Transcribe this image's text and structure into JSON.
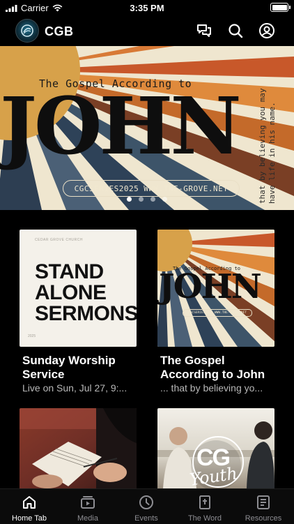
{
  "status": {
    "carrier": "Carrier",
    "time": "3:35 PM"
  },
  "header": {
    "app_name": "CGB"
  },
  "hero": {
    "subtitle": "The Gospel According to",
    "title": "JOHN",
    "vertical_text": "that by believing you may have life in his name.",
    "pill_text": "CGCSERIES2025  WWW.THE-GROVE.NET",
    "page_count": 4,
    "active_page": 1
  },
  "cards": [
    {
      "title": "Sunday Worship Service",
      "subtitle": "Live on Sun, Jul 27, 9:...",
      "thumb": {
        "church": "CEDAR GROVE CHURCH",
        "headline": [
          "STAND",
          "ALONE",
          "SERMONS"
        ],
        "year": "2025"
      }
    },
    {
      "title": "The Gospel According to John",
      "subtitle": "... that by believing yo...",
      "thumb": {
        "subtitle": "The Gospel According to",
        "title": "JOHN",
        "pill_text": "CGCSERIES2025  WWW.THE-GROVE.NET"
      }
    },
    {
      "title": "",
      "subtitle": "",
      "thumb": {
        "kind": "journal-photo"
      }
    },
    {
      "title": "",
      "subtitle": "",
      "thumb": {
        "kind": "youth-photo",
        "logo_text": "CG",
        "logo_script": "Youth"
      }
    }
  ],
  "tabs": [
    {
      "label": "Home Tab",
      "icon": "home-icon",
      "active": true
    },
    {
      "label": "Media",
      "icon": "media-icon",
      "active": false
    },
    {
      "label": "Events",
      "icon": "clock-icon",
      "active": false
    },
    {
      "label": "The Word",
      "icon": "bible-icon",
      "active": false
    },
    {
      "label": "Resources",
      "icon": "resources-icon",
      "active": false
    }
  ],
  "colors": {
    "background": "#000000",
    "tab_inactive": "#8e8e93",
    "card_subtitle": "#b8b8b8"
  }
}
